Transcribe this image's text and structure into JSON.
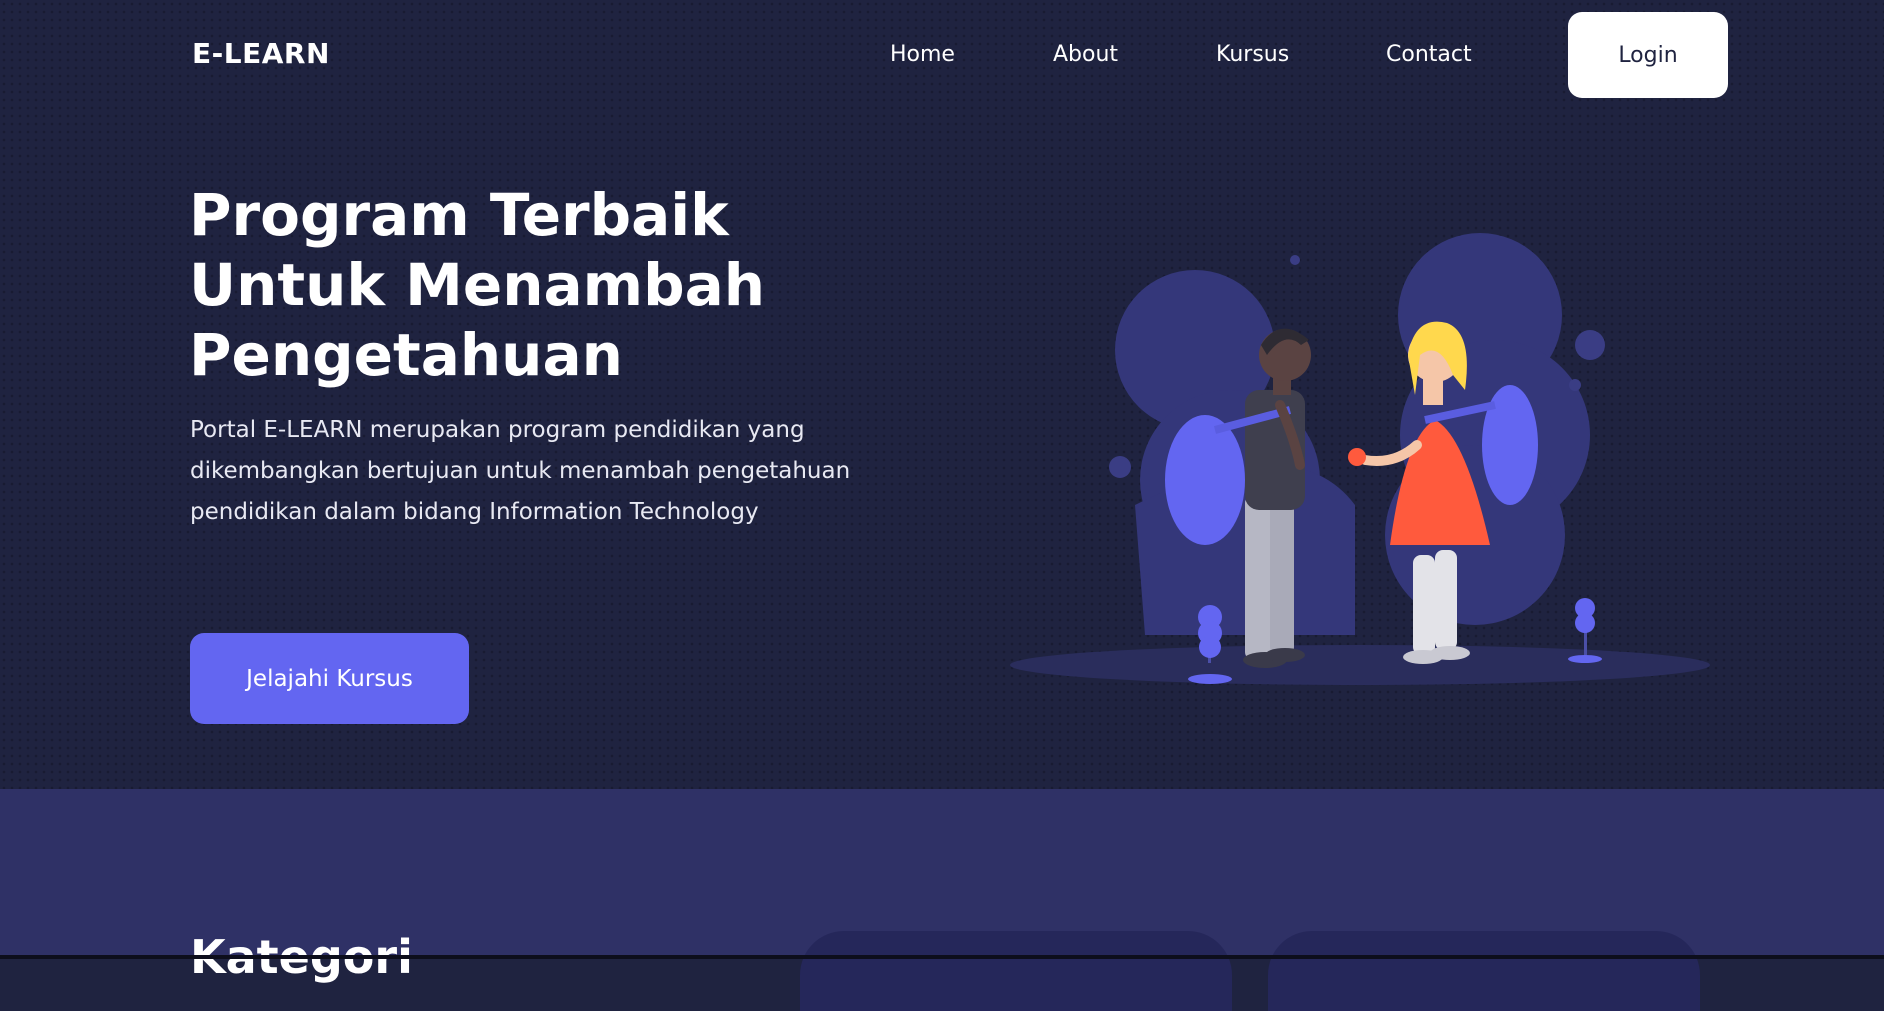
{
  "brand": "E-LEARN",
  "nav": {
    "items": [
      {
        "label": "Home"
      },
      {
        "label": "About"
      },
      {
        "label": "Kursus"
      },
      {
        "label": "Contact"
      }
    ],
    "login_label": "Login"
  },
  "hero": {
    "title_lines": [
      "Program Terbaik",
      "Untuk Menambah",
      "Pengetahuan"
    ],
    "description": "Portal E-LEARN merupakan program pendidikan yang dikembangkan bertujuan untuk menambah pengetahuan pendidikan dalam bidang Information Technology",
    "cta_label": "Jelajahi Kursus",
    "illustration": "two-students-with-backpacks-illustration"
  },
  "section2": {
    "title": "Kategori"
  },
  "colors": {
    "background": "#1f2340",
    "accent": "#6366f1",
    "section": "#2f3166",
    "text": "#ffffff"
  }
}
